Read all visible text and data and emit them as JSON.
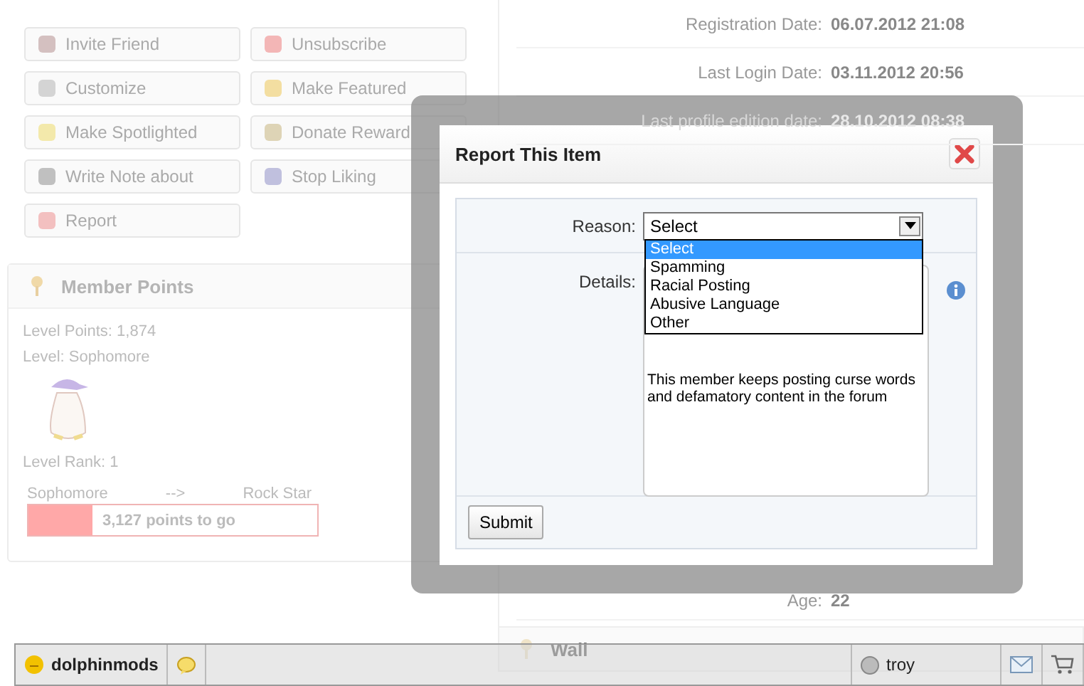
{
  "actions": [
    {
      "label": "Invite Friend"
    },
    {
      "label": "Unsubscribe"
    },
    {
      "label": "Customize"
    },
    {
      "label": "Make Featured"
    },
    {
      "label": "Make Spotlighted"
    },
    {
      "label": "Donate Reward"
    },
    {
      "label": "Write Note about"
    },
    {
      "label": "Stop Liking"
    },
    {
      "label": "Report"
    }
  ],
  "member_points": {
    "title": "Member Points",
    "lines": [
      "Level Points: 1,874",
      "Level: Sophomore"
    ],
    "rank": "Level Rank: 1",
    "progress": {
      "from": "Sophomore",
      "arrow": "-->",
      "to": "Rock Star",
      "level": 0.22,
      "text": "3,127 points to go"
    }
  },
  "profile_info": [
    {
      "label": "Registration Date:",
      "value": "06.07.2012 21:08"
    },
    {
      "label": "Last Login Date:",
      "value": "03.11.2012 20:56"
    },
    {
      "label": "Last profile edition date:",
      "value": "28.10.2012 08:38"
    }
  ],
  "age": {
    "label": "Age:",
    "value": "22"
  },
  "wall": {
    "title": "Wall"
  },
  "dialog": {
    "title": "Report This Item",
    "reason": {
      "label": "Reason:",
      "value": "Select",
      "open": true,
      "options": [
        {
          "label": "Select",
          "selected": true
        },
        {
          "label": "Spamming",
          "selected": false
        },
        {
          "label": "Racial Posting",
          "selected": false
        },
        {
          "label": "Abusive Language",
          "selected": false
        },
        {
          "label": "Other",
          "selected": false
        }
      ]
    },
    "details": {
      "label": "Details:",
      "value": "This member keeps posting curse words and defamatory content in the forum"
    },
    "submit": "Submit"
  },
  "bottom_bar": {
    "user": "dolphinmods",
    "friend": "troy"
  }
}
